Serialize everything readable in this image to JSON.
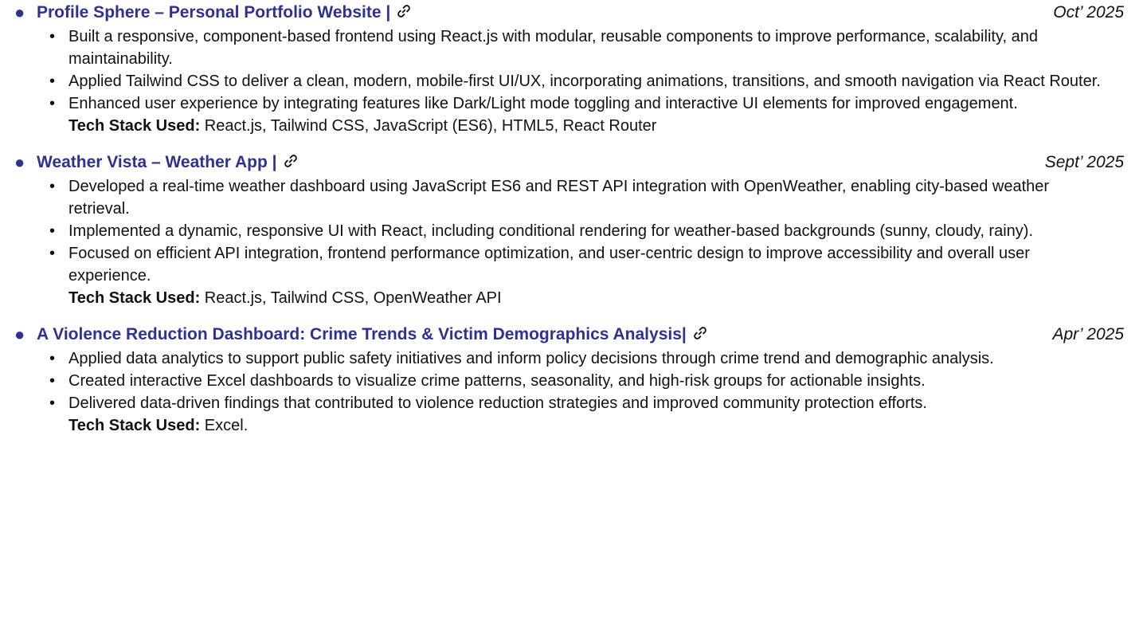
{
  "link_icon": "link-icon",
  "colors": {
    "project_title": "#2f3191",
    "body_text": "#111111"
  },
  "projects": [
    {
      "title": "Profile Sphere – Personal Portfolio Website |",
      "date": "Oct’ 2025",
      "bullets": [
        "Built a responsive, component-based frontend using React.js with modular, reusable components to improve performance, scalability, and maintainability.",
        "Applied Tailwind CSS to deliver a clean, modern, mobile-first UI/UX, incorporating animations, transitions, and smooth navigation via React Router.",
        "Enhanced user experience by integrating features like Dark/Light mode toggling and interactive UI elements for improved engagement."
      ],
      "tech_label": "Tech Stack Used:",
      "tech_value": " React.js, Tailwind CSS, JavaScript (ES6), HTML5, React Router"
    },
    {
      "title": "Weather Vista – Weather App |",
      "date": "Sept’ 2025",
      "bullets": [
        "Developed a real-time weather dashboard using JavaScript ES6 and REST API integration with OpenWeather, enabling city-based weather retrieval.",
        "Implemented a dynamic, responsive UI with React, including conditional rendering for weather-based backgrounds (sunny, cloudy, rainy).",
        "Focused on efficient API integration, frontend performance optimization, and user-centric design to improve accessibility and overall user experience."
      ],
      "tech_label": "Tech Stack Used:",
      "tech_value": " React.js, Tailwind CSS, OpenWeather API"
    },
    {
      "title": "A Violence Reduction Dashboard: Crime Trends & Victim Demographics Analysis|",
      "date": "Apr’ 2025",
      "bullets": [
        "Applied data analytics to support public safety initiatives and inform policy decisions through crime trend and demographic analysis.",
        "Created interactive Excel dashboards to visualize crime patterns, seasonality, and high-risk groups for actionable insights.",
        "Delivered data-driven findings that contributed to violence reduction strategies and improved community protection efforts."
      ],
      "tech_label": "Tech Stack Used:",
      "tech_value": " Excel."
    }
  ]
}
